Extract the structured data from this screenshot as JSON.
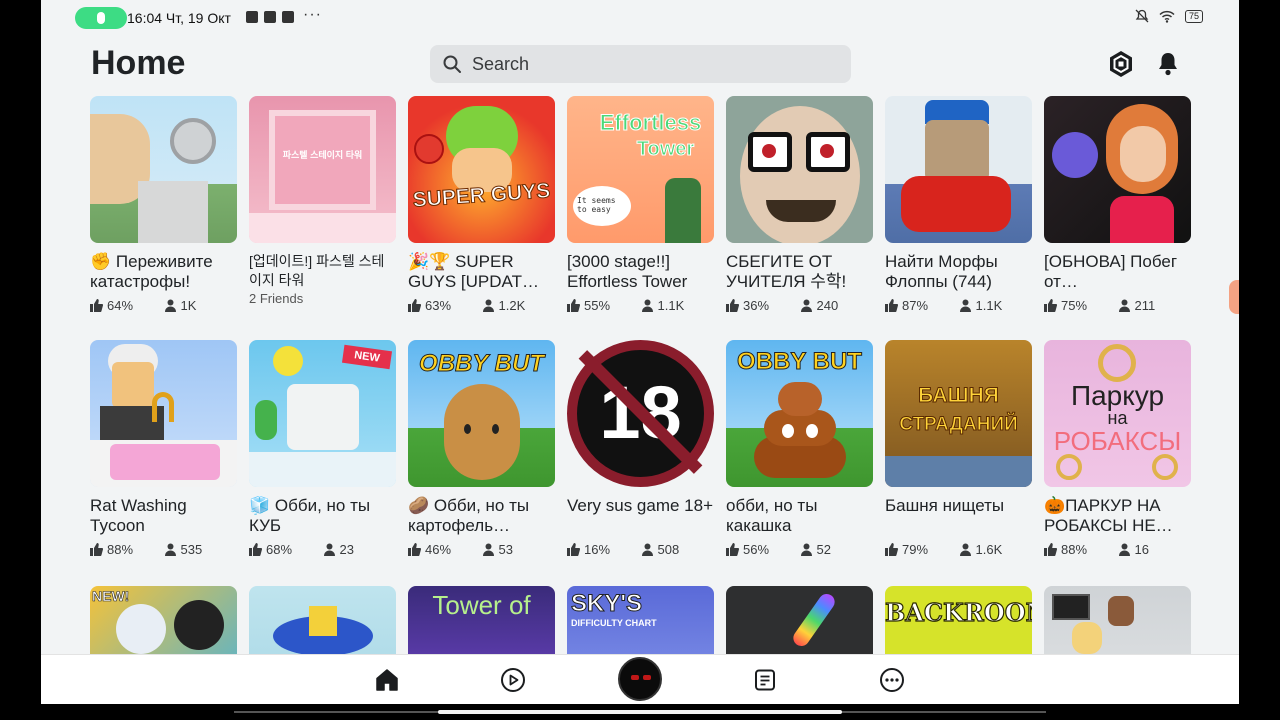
{
  "status_bar": {
    "time": "16:04 Чт, 19 Окт",
    "battery": "75"
  },
  "header": {
    "title": "Home",
    "search_placeholder": "Search"
  },
  "games": [
    {
      "title": "✊ Переживите катастрофы!",
      "rating": "64%",
      "players": "1K"
    },
    {
      "title": "[업데이트!] 파스텔 스테이지 타워",
      "friends": "2 Friends"
    },
    {
      "title": "🎉🏆 SUPER GUYS [UPDAT…",
      "rating": "63%",
      "players": "1.2K"
    },
    {
      "title": "[3000 stage!!] Effortless Tower",
      "rating": "55%",
      "players": "1.1K"
    },
    {
      "title": "СБЕГИТЕ ОТ УЧИТЕЛЯ 수학!",
      "rating": "36%",
      "players": "240"
    },
    {
      "title": "Найти Морфы Флоппы (744)",
      "rating": "87%",
      "players": "1.1K"
    },
    {
      "title": "[ОБНОВА] Побег от…",
      "rating": "75%",
      "players": "211"
    },
    {
      "title": "Rat Washing Tycoon",
      "rating": "88%",
      "players": "535"
    },
    {
      "title": "🧊 Обби, но ты КУБ",
      "rating": "68%",
      "players": "23"
    },
    {
      "title": "🥔 Обби, но ты картофель…",
      "rating": "46%",
      "players": "53"
    },
    {
      "title": "Very sus game 18+",
      "rating": "16%",
      "players": "508"
    },
    {
      "title": "обби, но ты какашка",
      "rating": "56%",
      "players": "52"
    },
    {
      "title": "Башня нищеты",
      "rating": "79%",
      "players": "1.6K"
    },
    {
      "title": "🎃ПАРКУР НА РОБАКСЫ НЕ…",
      "rating": "88%",
      "players": "16"
    },
    {
      "title": ""
    },
    {
      "title": ""
    },
    {
      "title": ""
    },
    {
      "title": ""
    },
    {
      "title": ""
    },
    {
      "title": ""
    },
    {
      "title": ""
    }
  ],
  "thumb_text": {
    "super_guys": "SUPER GUYS",
    "effortless_1": "Effortless",
    "effortless_2": "Tower",
    "effortless_bubble": "It seems to easy",
    "pastel_sign": "파스텔 스테이지 타워",
    "new_badge": "NEW",
    "obby_but": "OBBY BUT",
    "eighteen": "18",
    "bashnya_1": "БАШНЯ",
    "bashnya_2": "СТРАДАНИЙ",
    "parkour_1": "Паркур",
    "parkour_2": "на",
    "parkour_3": "РОБАКСЫ",
    "new_excl": "NEW!",
    "tower_of": "Tower of",
    "skys_1": "SKY'S",
    "skys_2": "DIFFICULTY CHART",
    "backrooms": "BACKROOMS"
  },
  "colors": {
    "accent_green": "#3ddc84",
    "text": "#202326",
    "bg": "#f2f4f5"
  },
  "nav": [
    "home-icon",
    "play-icon",
    "avatar",
    "list-icon",
    "more-icon"
  ]
}
